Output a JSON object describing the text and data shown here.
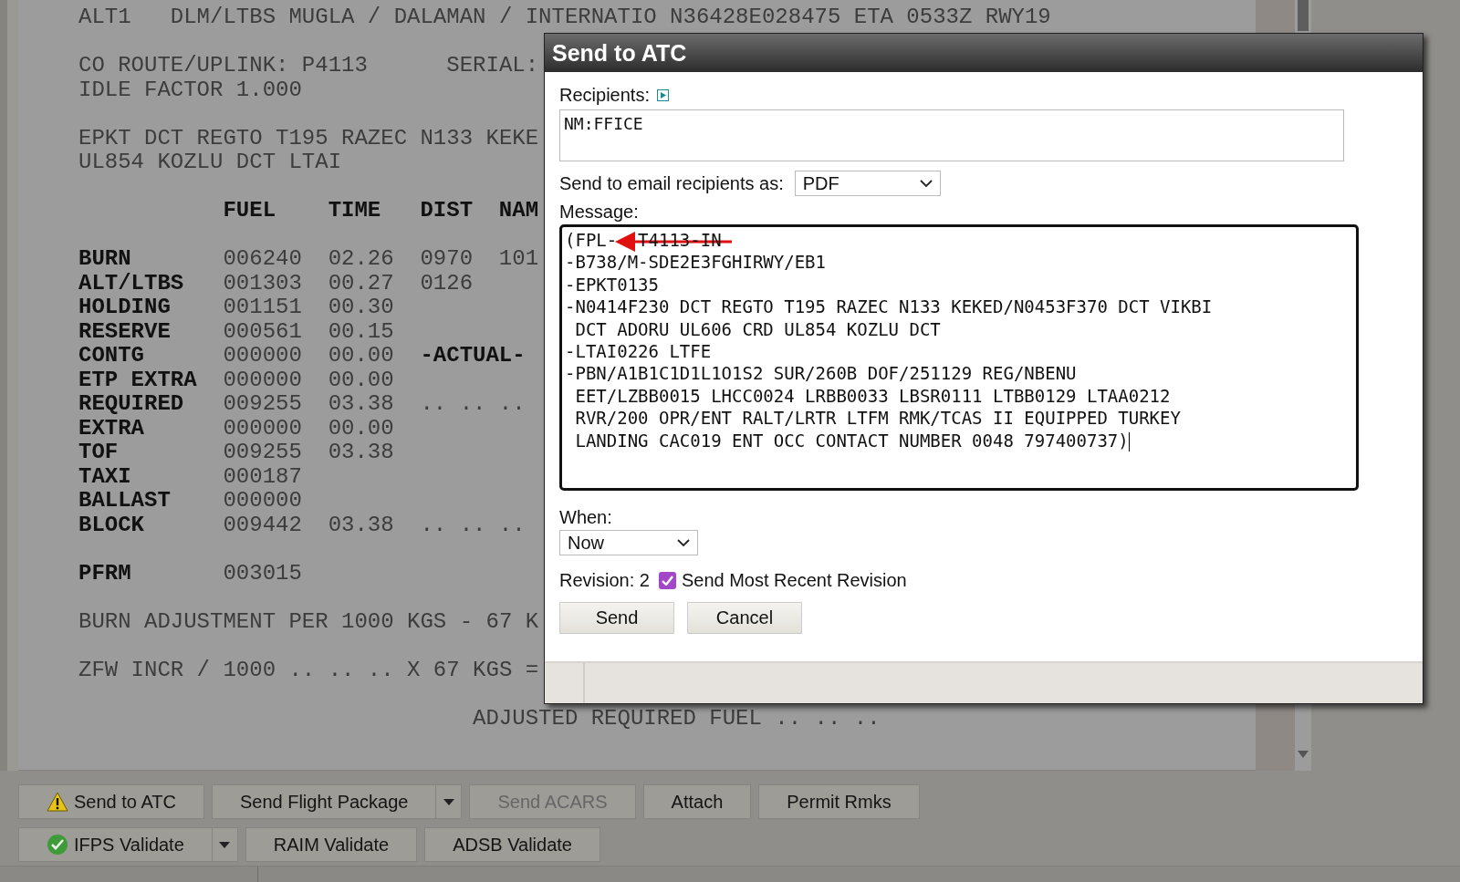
{
  "document": {
    "blocks": [
      [
        [
          "ALT1   DLM/LTBS MUGLA / DALAMAN / INTERNATIO N36428E028475 ETA 0533Z RWY19"
        ]
      ],
      [
        [
          "CO ROUTE/UPLINK: P4113",
          "SERIAL:"
        ],
        [
          "IDLE FACTOR 1.000"
        ]
      ],
      [
        [
          "EPKT DCT REGTO T195 RAZEC N133 KEKE"
        ],
        [
          "UL854 KOZLU DCT LTAI"
        ]
      ]
    ],
    "fuel_table": {
      "columns": [
        "FUEL",
        "TIME",
        "DIST",
        "NAM"
      ],
      "row_groups": [
        [
          {
            "label": "BURN",
            "values": [
              "006240",
              "02.26",
              "0970",
              "101"
            ]
          },
          {
            "label": "ALT/LTBS",
            "values": [
              "001303",
              "00.27",
              "0126"
            ]
          },
          {
            "label": "HOLDING",
            "values": [
              "001151",
              "00.30"
            ]
          },
          {
            "label": "RESERVE",
            "values": [
              "000561",
              "00.15"
            ]
          },
          {
            "label": "CONTG",
            "values": [
              "000000",
              "00.00"
            ],
            "note": "-ACTUAL-"
          },
          {
            "label": "ETP EXTRA",
            "values": [
              "000000",
              "00.00"
            ]
          },
          {
            "label": "REQUIRED",
            "values": [
              "009255",
              "03.38",
              ".. .. .."
            ]
          },
          {
            "label": "EXTRA",
            "values": [
              "000000",
              "00.00"
            ]
          },
          {
            "label": "TOF",
            "values": [
              "009255",
              "03.38"
            ]
          },
          {
            "label": "TAXI",
            "values": [
              "000187"
            ]
          },
          {
            "label": "BALLAST",
            "values": [
              "000000"
            ]
          },
          {
            "label": "BLOCK",
            "values": [
              "009442",
              "03.38",
              ".. .. .."
            ]
          }
        ],
        [
          {
            "label": "PFRM",
            "values": [
              "003015"
            ]
          }
        ]
      ]
    },
    "notes": [
      "BURN ADJUSTMENT PER 1000 KGS - 67 K",
      "ZFW INCR / 1000 .. .. .. X 67 KGS ="
    ],
    "summary_line": "ADJUSTED REQUIRED FUEL .. .. .."
  },
  "dialog": {
    "title": "Send to ATC",
    "recipients": {
      "label": "Recipients:",
      "value": "NM:FFICE"
    },
    "email_format": {
      "label": "Send to email recipients as:",
      "value": "PDF"
    },
    "message": {
      "label": "Message:",
      "first_line": [
        "(FPL-",
        "T4113-IN"
      ],
      "lines": [
        "-B738/M-SDE2E3FGHIRWY/EB1",
        "-EPKT0135",
        "-N0414F230 DCT REGTO T195 RAZEC N133 KEKED/N0453F370 DCT VIKBI",
        " DCT ADORU UL606 CRD UL854 KOZLU DCT",
        "-LTAI0226 LTFE",
        "-PBN/A1B1C1D1L1O1S2 SUR/260B DOF/251129 REG/NBENU",
        " EET/LZBB0015 LHCC0024 LRBB0033 LBSR0111 LTBB0129 LTAA0212",
        " RVR/200 OPR/ENT RALT/LRTR LTFM RMK/TCAS II EQUIPPED TURKEY",
        " LANDING CAC019 ENT OCC CONTACT NUMBER 0048 797400737)"
      ]
    },
    "when": {
      "label": "When:",
      "value": "Now"
    },
    "revision": {
      "label": "Revision: 2",
      "checked": true,
      "option": "Send Most Recent Revision"
    },
    "buttons": [
      "Send",
      "Cancel"
    ]
  },
  "toolbar": {
    "rows": [
      [
        {
          "label": "Send to ATC",
          "kind": "warning",
          "split": false,
          "disabled": false
        },
        {
          "label": "Send Flight Package",
          "split": true,
          "disabled": false
        },
        {
          "label": "Send ACARS",
          "split": false,
          "disabled": true
        },
        {
          "label": "Attach",
          "split": false,
          "disabled": false
        },
        {
          "label": "Permit Rmks",
          "split": false,
          "disabled": false
        }
      ],
      [
        {
          "label": "IFPS Validate",
          "kind": "check",
          "split": true,
          "disabled": false
        },
        {
          "label": "RAIM Validate",
          "split": false,
          "disabled": false
        },
        {
          "label": "ADSB Validate",
          "split": false,
          "disabled": false
        }
      ]
    ]
  }
}
